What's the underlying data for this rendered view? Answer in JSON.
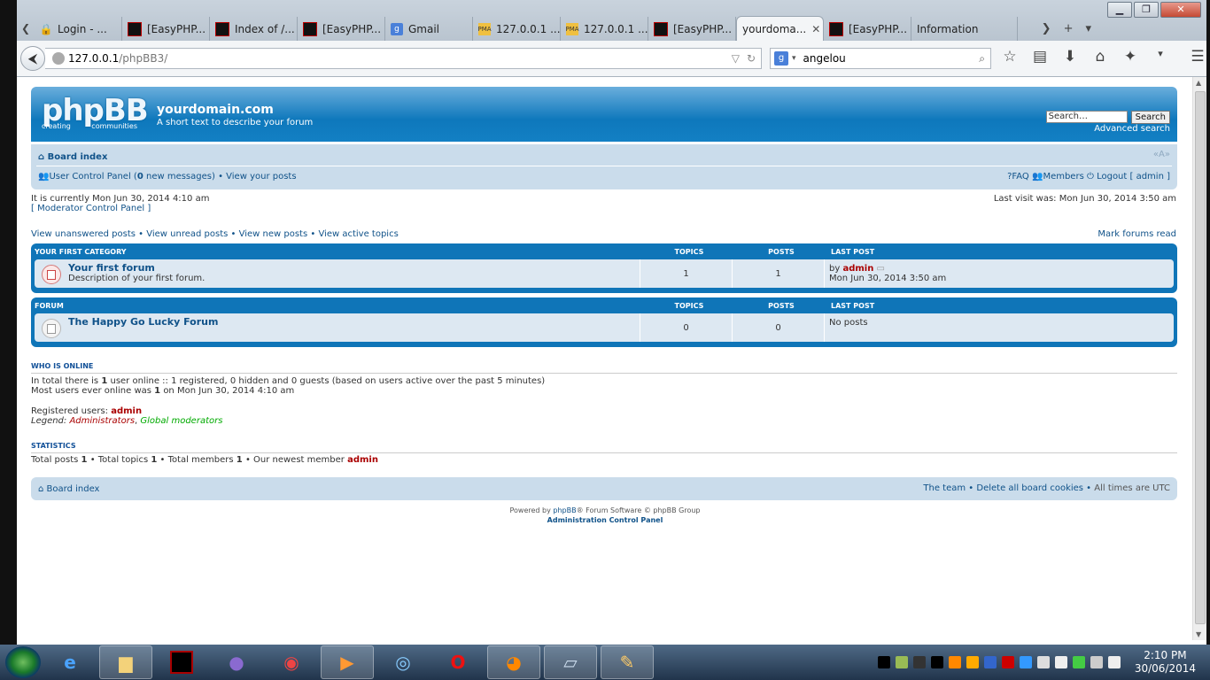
{
  "browser": {
    "tabs": [
      {
        "label": "Login - ...",
        "icon": "lock-icon"
      },
      {
        "label": "[EasyPHP...",
        "icon": "easyphp-icon"
      },
      {
        "label": "Index of /...",
        "icon": "easyphp-icon"
      },
      {
        "label": "[EasyPHP...",
        "icon": "easyphp-icon"
      },
      {
        "label": "Gmail",
        "icon": "google-icon"
      },
      {
        "label": "127.0.0.1 ...",
        "icon": "phpmyadmin-icon"
      },
      {
        "label": "127.0.0.1 ...",
        "icon": "phpmyadmin-icon"
      },
      {
        "label": "[EasyPHP...",
        "icon": "easyphp-icon"
      },
      {
        "label": "yourdoma...",
        "icon": "none",
        "active": true
      },
      {
        "label": "[EasyPHP...",
        "icon": "easyphp-icon"
      },
      {
        "label": "Information",
        "icon": "none"
      }
    ],
    "url_host": "127.0.0.1",
    "url_path": "/phpBB3/",
    "search_value": "angelou"
  },
  "forum": {
    "logo_text": "phpBB",
    "logo_sub_left": "creating",
    "logo_sub_right": "communities",
    "site_title": "yourdomain.com",
    "site_desc": "A short text to describe your forum",
    "search_placeholder": "Search…",
    "search_button": "Search",
    "advanced_search": "Advanced search",
    "breadcrumb": "Board index",
    "font_size_toggle": "«A»",
    "ucp_label": "User Control Panel",
    "new_messages_count": "0",
    "new_messages_text": "new messages",
    "view_your_posts": "View your posts",
    "faq": "FAQ",
    "members": "Members",
    "logout": "Logout [ admin ]",
    "current_time": "It is currently Mon Jun 30, 2014 4:10 am",
    "last_visit": "Last visit was: Mon Jun 30, 2014 3:50 am",
    "mcp": "[ Moderator Control Panel ]",
    "view_links": [
      "View unanswered posts",
      "View unread posts",
      "View new posts",
      "View active topics"
    ],
    "mark_read": "Mark forums read",
    "col_topics": "TOPICS",
    "col_posts": "POSTS",
    "col_last_post": "LAST POST",
    "categories": [
      {
        "name": "YOUR FIRST CATEGORY",
        "forum_title": "Your first forum",
        "forum_desc": "Description of your first forum.",
        "topics": "1",
        "posts": "1",
        "last_by": "by",
        "last_user": "admin",
        "last_date": "Mon Jun 30, 2014 3:50 am"
      },
      {
        "name": "FORUM",
        "forum_title": "The Happy Go Lucky Forum",
        "forum_desc": "",
        "topics": "0",
        "posts": "0",
        "last_by": "No posts",
        "last_user": "",
        "last_date": ""
      }
    ],
    "who_online_head": "WHO IS ONLINE",
    "online_line1_a": "In total there is",
    "online_count": "1",
    "online_line1_b": "user online :: 1 registered, 0 hidden and 0 guests (based on users active over the past 5 minutes)",
    "online_line2_a": "Most users ever online was",
    "online_max": "1",
    "online_line2_b": "on Mon Jun 30, 2014 4:10 am",
    "registered_label": "Registered users:",
    "registered_user": "admin",
    "legend_label": "Legend:",
    "legend_admins": "Administrators",
    "legend_gmods": "Global moderators",
    "stats_head": "STATISTICS",
    "stats_a": "Total posts",
    "stats_posts": "1",
    "stats_b": "• Total topics",
    "stats_topics": "1",
    "stats_c": "• Total members",
    "stats_members": "1",
    "stats_d": "• Our newest member",
    "stats_newest": "admin",
    "footer_crumb": "Board index",
    "footer_team": "The team",
    "footer_delete_cookies": "Delete all board cookies",
    "footer_times": "All times are UTC",
    "powered_a": "Powered by",
    "powered_link": "phpBB",
    "powered_b": "® Forum Software © phpBB Group",
    "acp": "Administration Control Panel"
  },
  "taskbar": {
    "time": "2:10 PM",
    "date": "30/06/2014"
  }
}
